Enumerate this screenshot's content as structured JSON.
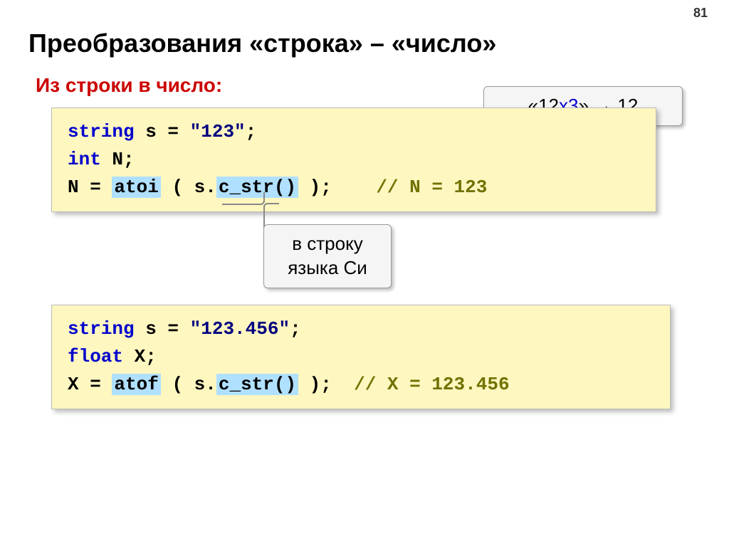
{
  "page_number": "81",
  "title": "Преобразования «строка» – «число»",
  "subtitle": "Из строки в число:",
  "callouts": {
    "top_left": "«12",
    "top_mid": "х3",
    "top_right": "» ",
    "top_arrow": "→",
    "top_result": " 12",
    "mid_line1": "в строку",
    "mid_line2": "языка Си"
  },
  "code1": {
    "l1_kw": "string",
    "l1_rest": " s = ",
    "l1_lit": "\"123\"",
    "l1_semi": ";",
    "l2_kw": "int",
    "l2_rest": " N;",
    "l3_a": "N = ",
    "l3_fn": "atoi",
    "l3_b": " ( s.",
    "l3_cstr": "c_str()",
    "l3_c": " );",
    "l3_pad": "    ",
    "l3_comment": "// N = 123"
  },
  "code2": {
    "l1_kw": "string",
    "l1_rest": " s = ",
    "l1_lit": "\"123.456\"",
    "l1_semi": ";",
    "l2_kw": "float",
    "l2_rest": " X;",
    "l3_a": "X = ",
    "l3_fn": "atof",
    "l3_b": " ( s.",
    "l3_cstr": "c_str()",
    "l3_c": " );",
    "l3_pad": "  ",
    "l3_comment": "// X = 123.456"
  }
}
